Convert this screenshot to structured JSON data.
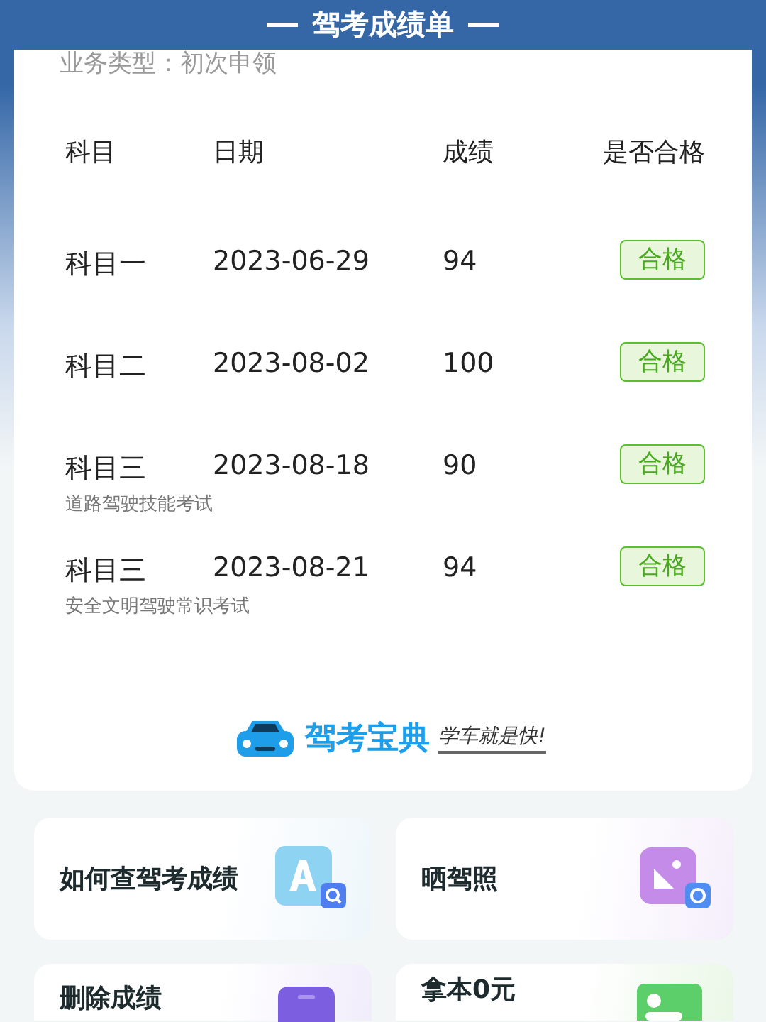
{
  "header": {
    "title": "驾考成绩单"
  },
  "business_type": "业务类型：初次申领",
  "table": {
    "columns": [
      "科目",
      "日期",
      "成绩",
      "是否合格"
    ],
    "rows": [
      {
        "subject": "科目一",
        "date": "2023-06-29",
        "score": "94",
        "result": "合格",
        "passed": true
      },
      {
        "subject": "科目二",
        "date": "2023-08-02",
        "score": "100",
        "result": "合格",
        "passed": true
      },
      {
        "subject": "科目三",
        "note": "道路驾驶技能考试",
        "date": "2023-08-18",
        "score": "90",
        "result": "合格",
        "passed": true
      },
      {
        "subject": "科目三",
        "note": "安全文明驾驶常识考试",
        "date": "2023-08-21",
        "score": "94",
        "result": "合格",
        "passed": true
      }
    ]
  },
  "brand": {
    "name": "驾考宝典",
    "slogan": "学车就是快!"
  },
  "tiles": [
    {
      "label": "如何查驾考成绩",
      "kind": "search"
    },
    {
      "label": "晒驾照",
      "kind": "photo"
    },
    {
      "label": "删除成绩",
      "kind": "delete"
    },
    {
      "label": "拿本0元",
      "kind": "license"
    }
  ]
}
